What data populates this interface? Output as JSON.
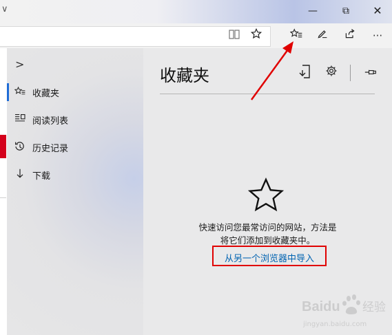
{
  "titlebar": {
    "chevron": "∨",
    "minimize": "—",
    "maximize": "⧉",
    "close": "✕"
  },
  "toolbar": {
    "icons": [
      "reading-view-icon",
      "star-icon",
      "favorites-hub-icon",
      "pen-icon",
      "share-icon",
      "more-icon"
    ],
    "more": "···"
  },
  "hub": {
    "expand": ">",
    "items": [
      {
        "label": "收藏夹",
        "icon": "favorites-icon",
        "active": true
      },
      {
        "label": "阅读列表",
        "icon": "reading-list-icon",
        "active": false
      },
      {
        "label": "历史记录",
        "icon": "history-icon",
        "active": false
      },
      {
        "label": "下载",
        "icon": "download-icon",
        "active": false
      }
    ]
  },
  "panel": {
    "title": "收藏夹",
    "empty_line1": "快速访问您最常访问的网站，方法是",
    "empty_line2": "将它们添加到收藏夹中。",
    "import_link": "从另一个浏览器中导入"
  },
  "annotations": {
    "arrow_color": "#e00000",
    "highlight_color": "#e00000"
  },
  "watermark": {
    "brand": "Baidu",
    "tag": "经验",
    "url": "jingyan.baidu.com"
  }
}
